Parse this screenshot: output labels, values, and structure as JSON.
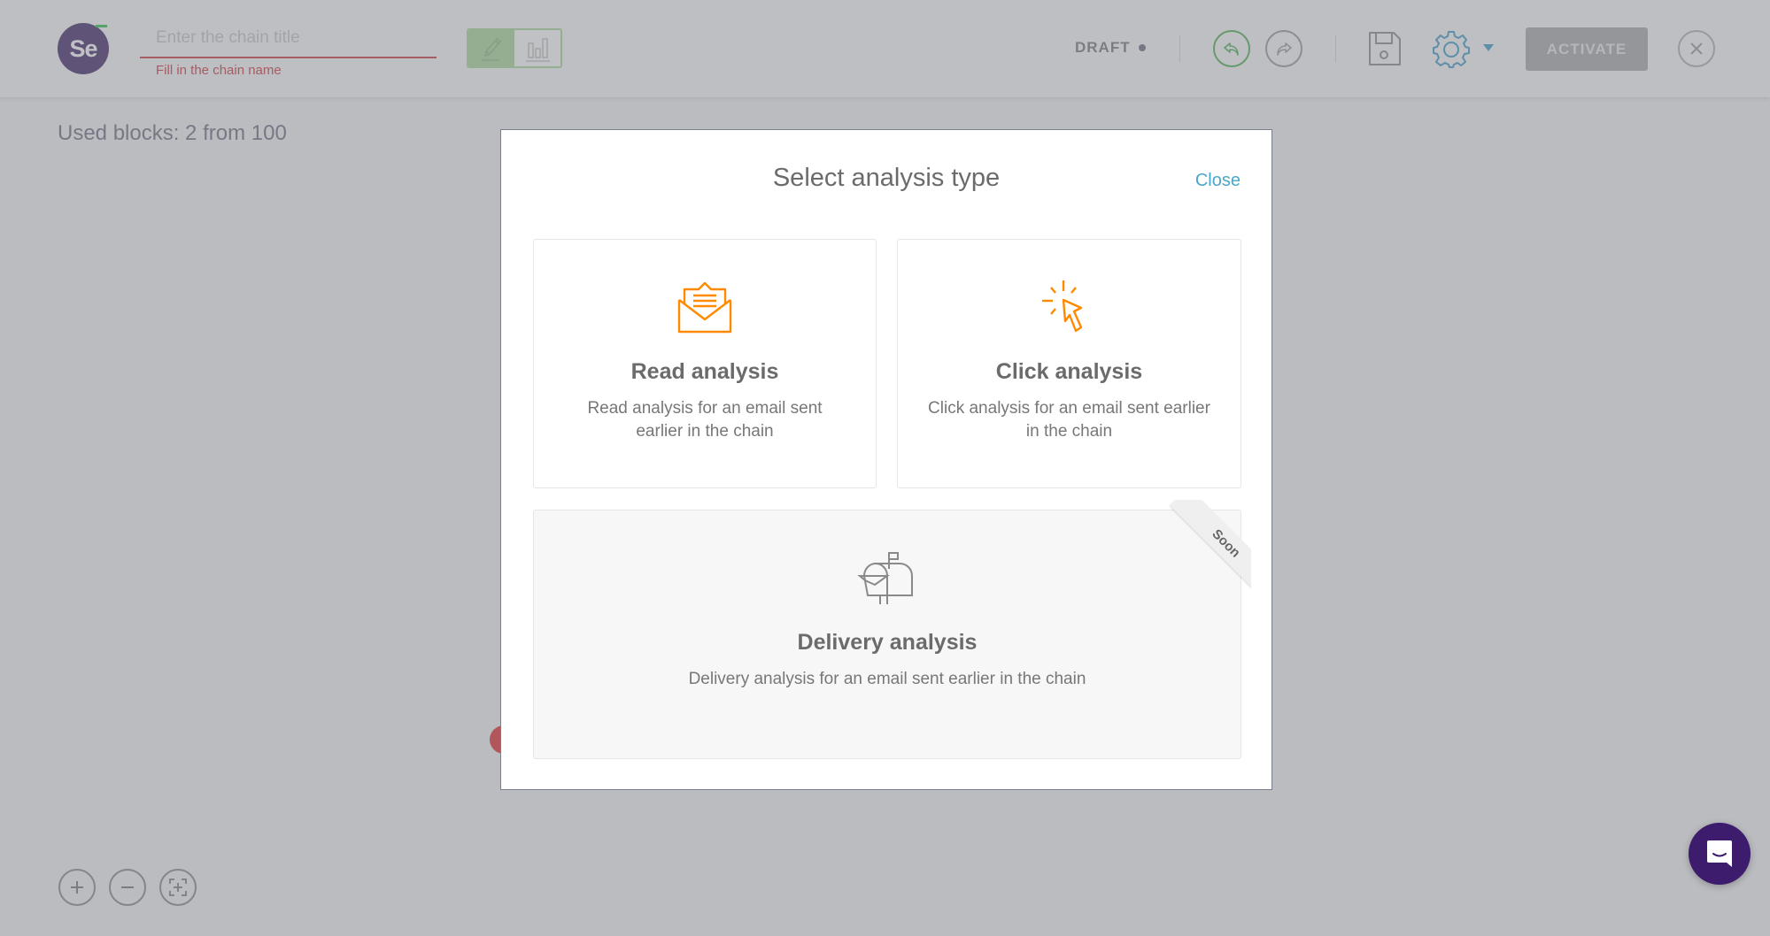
{
  "header": {
    "logo_text": "Se",
    "title_input": {
      "value": "",
      "placeholder": "Enter the chain title",
      "error": "Fill in the chain name"
    },
    "mode_toggle": {
      "options": [
        "edit",
        "statistics"
      ],
      "active": "edit"
    },
    "status": "DRAFT",
    "activate_label": "ACTIVATE",
    "colors": {
      "logo_bg": "#3d2566",
      "logo_accent": "#26c24a",
      "error": "#c8343b",
      "toggle_active": "#a8d89a",
      "undo": "#4caf50",
      "settings": "#3a9ac9"
    }
  },
  "canvas": {
    "used_blocks_text": "Used blocks: 2 from 100"
  },
  "modal": {
    "title": "Select analysis type",
    "close_label": "Close",
    "options": [
      {
        "id": "read",
        "icon": "open-envelope-icon",
        "title": "Read analysis",
        "description": "Read analysis for an email sent earlier in the chain",
        "available": true
      },
      {
        "id": "click",
        "icon": "cursor-click-icon",
        "title": "Click analysis",
        "description": "Click analysis for an email sent earlier in the chain",
        "available": true
      },
      {
        "id": "delivery",
        "icon": "mailbox-icon",
        "title": "Delivery analysis",
        "description": "Delivery analysis for an email sent earlier in the chain",
        "available": false,
        "badge": "Soon"
      }
    ],
    "accent_color": "#ff8a00",
    "close_color": "#4aa8c8"
  }
}
